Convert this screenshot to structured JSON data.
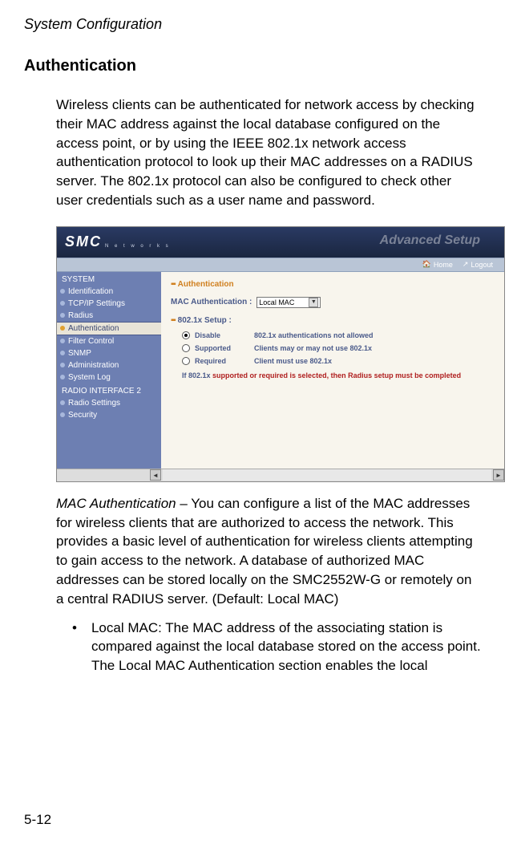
{
  "header": "System Configuration",
  "sectionTitle": "Authentication",
  "introPara": "Wireless clients can be authenticated for network access by checking their MAC address against the local database configured on the access point, or by using the IEEE 802.1x network access authentication protocol to look up their MAC addresses on a RADIUS server. The 802.1x protocol can also be configured to check other user credentials such as a user name and password.",
  "screenshot": {
    "logo": "SMC",
    "logoSub": "N e t w o r k s",
    "advSetup": "Advanced Setup",
    "toolbar": {
      "home": "Home",
      "logout": "Logout"
    },
    "sidebar": {
      "group1": "SYSTEM",
      "items1": [
        "Identification",
        "TCP/IP Settings",
        "Radius",
        "Authentication",
        "Filter Control",
        "SNMP",
        "Administration",
        "System Log"
      ],
      "group2": "RADIO INTERFACE 2",
      "items2": [
        "Radio Settings",
        "Security"
      ]
    },
    "content": {
      "crumb": "Authentication",
      "macAuthLabel": "MAC Authentication :",
      "macAuthValue": "Local MAC",
      "setupHeader": "802.1x Setup :",
      "radios": [
        {
          "label": "Disable",
          "desc": "802.1x authentications not allowed",
          "selected": true
        },
        {
          "label": "Supported",
          "desc": "Clients may or may not use 802.1x",
          "selected": false
        },
        {
          "label": "Required",
          "desc": "Client must use 802.1x",
          "selected": false
        }
      ],
      "warnPre": "If 802.1x ",
      "warnHl": "supported or required is selected, then Radius setup must be completed",
      "warnPost": ""
    }
  },
  "macAuth": {
    "label": "MAC Authentication",
    "text": " – You can configure a list of the MAC addresses for wireless clients that are authorized to access the network. This provides a basic level of authentication for wireless clients attempting to gain access to the network. A database of authorized MAC addresses can be stored locally on the SMC2552W-G or remotely on a central RADIUS server. (Default: Local MAC)"
  },
  "bullet": {
    "mark": "•",
    "text": "Local MAC: The MAC address of the associating station is compared against the local database stored on the access point. The Local MAC Authentication section enables the local"
  },
  "pageNum": "5-12"
}
